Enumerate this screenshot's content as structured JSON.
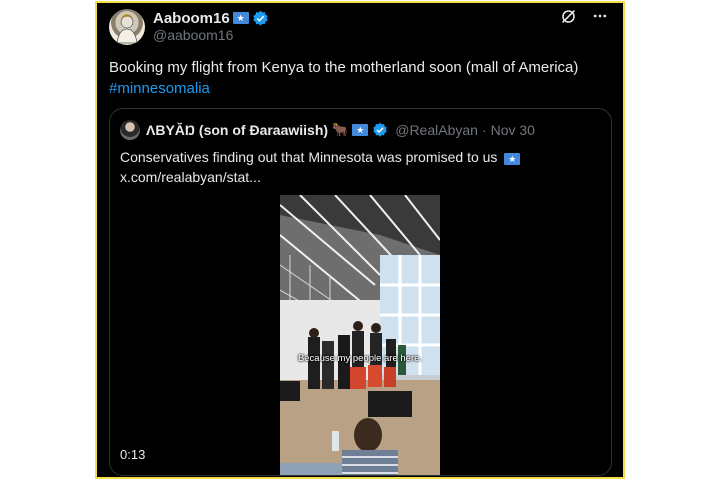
{
  "author": {
    "display_name": "Aaboom16",
    "handle": "@aaboom16"
  },
  "tweet": {
    "text": "Booking my flight from Kenya to the motherland soon (mall of America)",
    "hashtag": "#minnesomalia"
  },
  "quoted": {
    "display_name": "ΛBYĂŊ (son of Đaraawiish)",
    "handle": "@RealAbyan",
    "separator": "·",
    "date": "Nov 30",
    "text_line1": "Conservatives finding out that Minnesota was promised to us",
    "text_line2": "x.com/realabyan/stat...",
    "video": {
      "duration": "0:13",
      "caption": "Because my people are here."
    }
  },
  "colors": {
    "background": "#000000",
    "text": "#e7e9ea",
    "muted": "#71767b",
    "link": "#1d9bf0",
    "verified": "#1d9bf0",
    "frame_border": "#f2dd4a"
  },
  "icons": {
    "verified": "verified-badge-icon",
    "flag": "somalia-flag-icon",
    "emoji": "ox-emoji-icon",
    "grok": "grok-icon",
    "more": "more-icon"
  }
}
